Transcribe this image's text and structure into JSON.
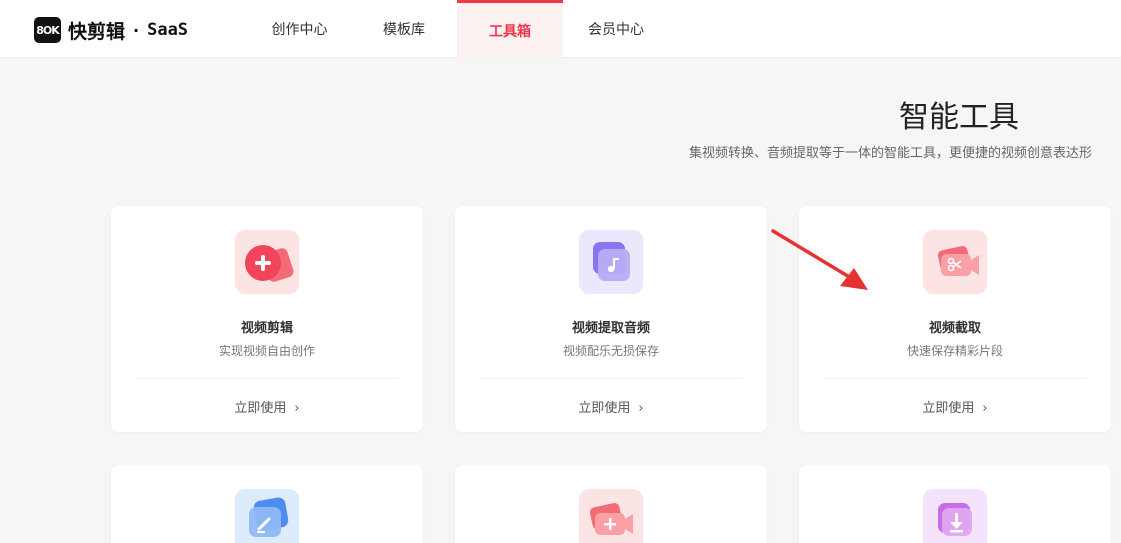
{
  "header": {
    "logo_mark": "8OK",
    "logo_text": "快剪辑",
    "logo_dot": "·",
    "logo_saas": "SaaS",
    "nav": [
      "创作中心",
      "模板库",
      "工具箱",
      "会员中心"
    ],
    "active_nav": "工具箱"
  },
  "page": {
    "title": "智能工具",
    "subtitle": "集视频转换、音频提取等于一体的智能工具，更便捷的视频创意表达形"
  },
  "tools_row1": [
    {
      "name": "视频剪辑",
      "desc": "实现视频自由创作",
      "action": "立即使用",
      "icon": "video-edit-plus-icon"
    },
    {
      "name": "视频提取音频",
      "desc": "视频配乐无损保存",
      "action": "立即使用",
      "icon": "music-note-icon"
    },
    {
      "name": "视频截取",
      "desc": "快速保存精彩片段",
      "action": "立即使用",
      "icon": "scissors-camera-icon"
    }
  ],
  "tools_row2_icons": [
    "pencil-edit-icon",
    "video-add-icon",
    "download-icon"
  ],
  "colors": {
    "accent": "#f0384b",
    "active_tab_bg": "#fbf1f1",
    "annotation_arrow": "#e8322f"
  }
}
